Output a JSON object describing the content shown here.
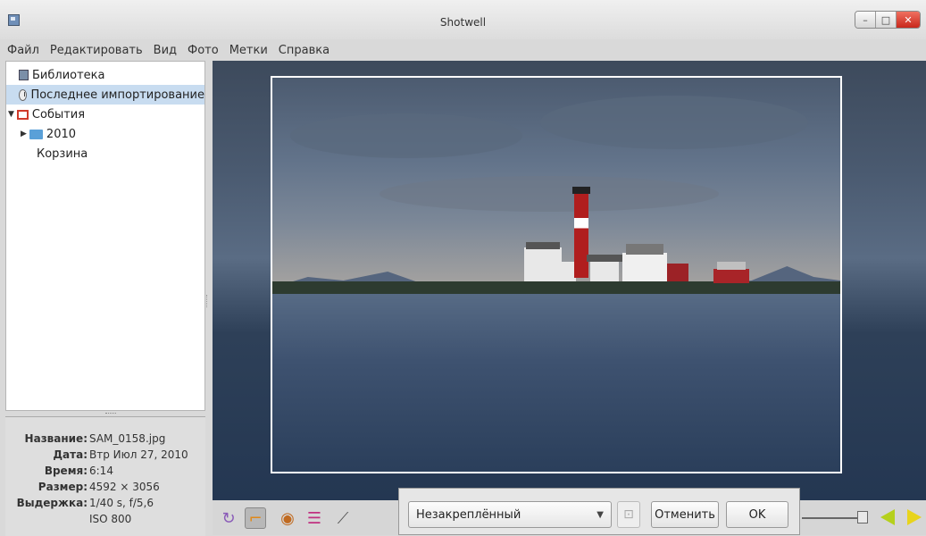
{
  "window": {
    "title": "Shotwell",
    "controls": [
      "minimize-icon",
      "maximize-icon",
      "close-icon"
    ]
  },
  "menubar": {
    "items": [
      "Файл",
      "Редактировать",
      "Вид",
      "Фото",
      "Метки",
      "Справка"
    ]
  },
  "sidebar": {
    "items": [
      {
        "label": "Библиотека",
        "icon": "library-icon"
      },
      {
        "label": "Последнее импортирование",
        "icon": "clock-icon",
        "selected": true
      },
      {
        "label": "События",
        "icon": "events-icon",
        "expanded": true
      },
      {
        "label": "2010",
        "icon": "folder-icon",
        "expanded": false
      },
      {
        "label": "Корзина",
        "icon": ""
      }
    ]
  },
  "metadata": {
    "rows": [
      {
        "label": "Название:",
        "value": "SAM_0158.jpg"
      },
      {
        "label": "Дата:",
        "value": "Втр Июл 27, 2010"
      },
      {
        "label": "Время:",
        "value": "6:14"
      },
      {
        "label": "Размер:",
        "value": "4592 × 3056"
      },
      {
        "label": "Выдержка:",
        "value": "1/40 s, f/5,6"
      },
      {
        "label": "",
        "value": "ISO 800"
      }
    ]
  },
  "toolbar": {
    "tools": [
      "rotate-icon",
      "crop-icon",
      "red-eye-icon",
      "adjust-icon",
      "enhance-icon"
    ],
    "active_tool": "crop-icon"
  },
  "crop_popup": {
    "constraint": "Незакреплённый",
    "cancel_label": "Отменить",
    "ok_label": "OK"
  },
  "colors": {
    "selection": "#c8dcf0",
    "nav_prev": "#b5d01c",
    "nav_next": "#e8d41c"
  }
}
